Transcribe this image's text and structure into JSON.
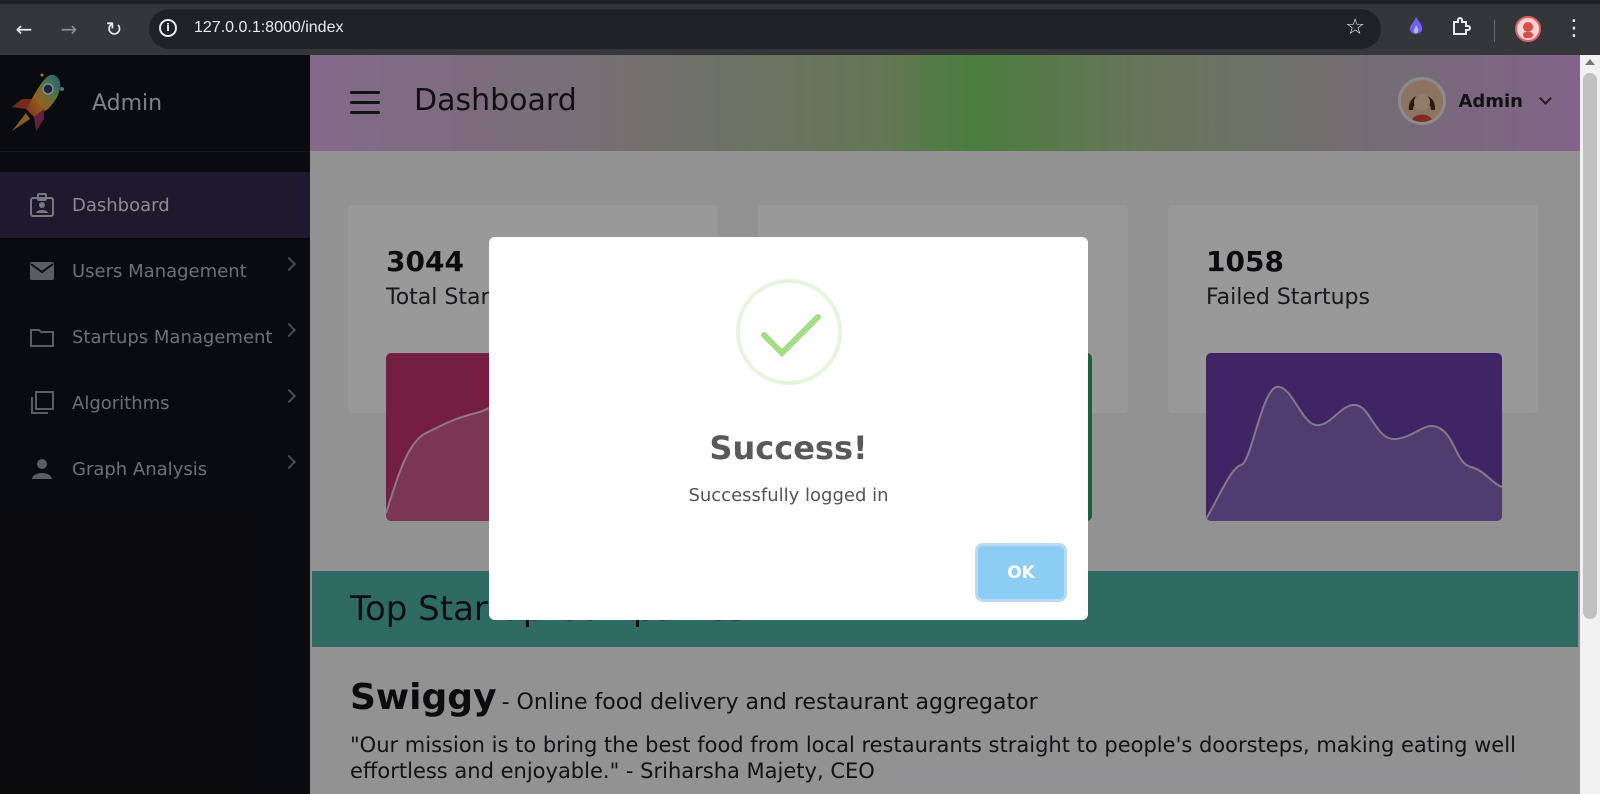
{
  "browser": {
    "url": "127.0.0.1:8000/index"
  },
  "sidebar": {
    "brand": "Admin",
    "items": [
      {
        "label": "Dashboard",
        "icon": "badge-icon",
        "active": true
      },
      {
        "label": "Users Management",
        "icon": "mail-icon",
        "active": false
      },
      {
        "label": "Startups Management",
        "icon": "folder-icon",
        "active": false
      },
      {
        "label": "Algorithms",
        "icon": "layers-icon",
        "active": false
      },
      {
        "label": "Graph Analysis",
        "icon": "person-icon",
        "active": false
      }
    ]
  },
  "header": {
    "title": "Dashboard",
    "user": "Admin"
  },
  "stats": [
    {
      "value": "3044",
      "label": "Total Startups",
      "color": "#c2346b"
    },
    {
      "value": "",
      "label": "",
      "color": "#3a9a6b"
    },
    {
      "value": "1058",
      "label": "Failed Startups",
      "color": "#6b3fa8"
    }
  ],
  "banner": {
    "title": "Top Startup Companies"
  },
  "company": {
    "name": "Swiggy",
    "description": "- Online food delivery and restaurant aggregator",
    "quote": "\"Our mission is to bring the best food from local restaurants straight to people's doorsteps, making eating well effortless and enjoyable.\" - Sriharsha Majety, CEO"
  },
  "modal": {
    "title": "Success!",
    "message": "Successfully logged in",
    "button": "OK"
  }
}
